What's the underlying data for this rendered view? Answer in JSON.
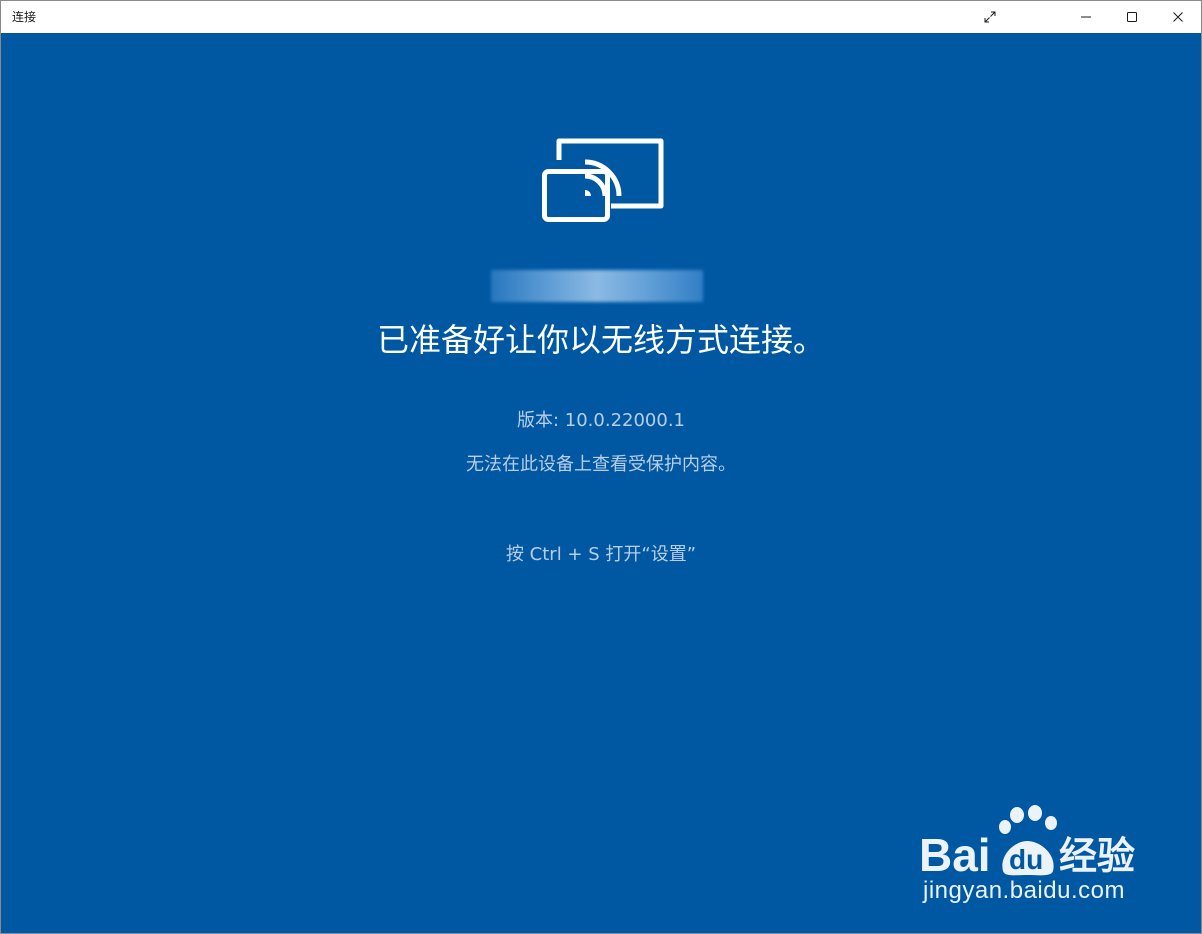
{
  "window": {
    "title": "连接"
  },
  "titlebar": {
    "fullscreen_icon": "expand-diagonal-icon",
    "minimize_icon": "minimize-icon",
    "maximize_icon": "maximize-icon",
    "close_icon": "close-icon"
  },
  "main": {
    "cast_icon": "cast-to-device-icon",
    "headline": "已准备好让你以无线方式连接。",
    "version": "版本: 10.0.22000.1",
    "protected_notice": "无法在此设备上查看受保护内容。",
    "settings_hint": "按 Ctrl + S 打开“设置”"
  },
  "watermark": {
    "logo_text_left": "Bai",
    "logo_text_du": "du",
    "logo_text_cn": "经验",
    "url": "jingyan.baidu.com"
  },
  "colors": {
    "background": "#0058a3",
    "text_primary": "#ffffff",
    "text_secondary": "#b9cde6",
    "titlebar": "#ffffff"
  }
}
